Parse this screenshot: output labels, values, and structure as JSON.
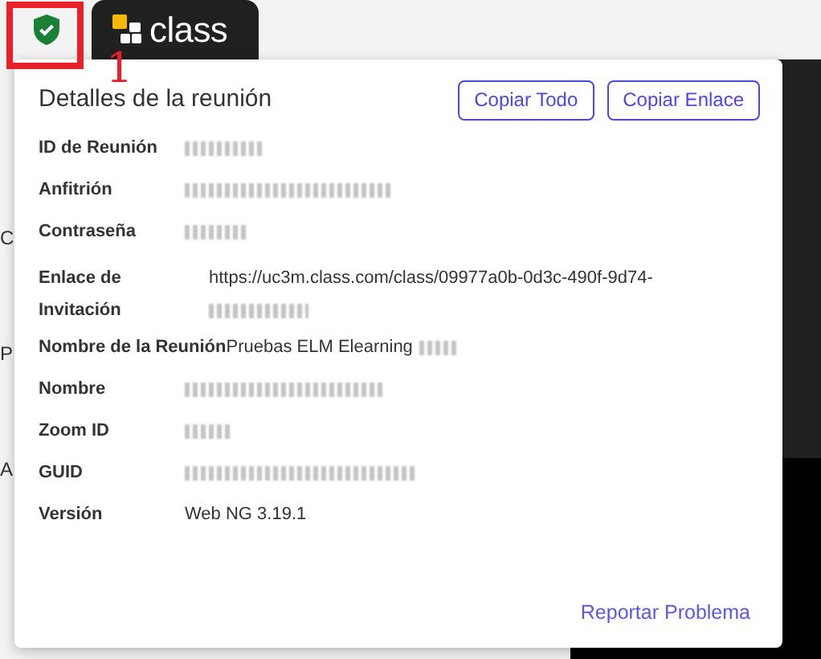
{
  "top_bar": {
    "verified": true,
    "logo_text": "class"
  },
  "annotation": {
    "number": "1"
  },
  "background_fragments": [
    "C",
    "P",
    "A"
  ],
  "popover": {
    "title": "Detalles de la reunión",
    "buttons": [
      "Copiar Todo",
      "Copiar Enlace"
    ],
    "rows": [
      {
        "kind": "plain",
        "label": "ID de Reunión",
        "blurred": true
      },
      {
        "kind": "plain",
        "label": "Anfitrión",
        "blurred": true
      },
      {
        "kind": "plain",
        "label": "Contraseña",
        "blurred": true
      },
      {
        "kind": "link",
        "label": "Enlace de Invitación",
        "value": "https://uc3m.class.com/class/09977a0b-0d3c-490f-9d74-",
        "blurred": true
      },
      {
        "kind": "inline",
        "label": "Nombre de la Reunión",
        "value": "Pruebas ELM Elearning",
        "blurred": true
      },
      {
        "kind": "plain",
        "label": "Nombre",
        "blurred": true
      },
      {
        "kind": "plain",
        "label": "Zoom ID",
        "blurred": true
      },
      {
        "kind": "plain",
        "label": "GUID",
        "blurred": true
      },
      {
        "kind": "plain",
        "label": "Versión",
        "value": "Web NG 3.19.1",
        "blurred": false
      }
    ],
    "footer_link": "Reportar Problema"
  }
}
